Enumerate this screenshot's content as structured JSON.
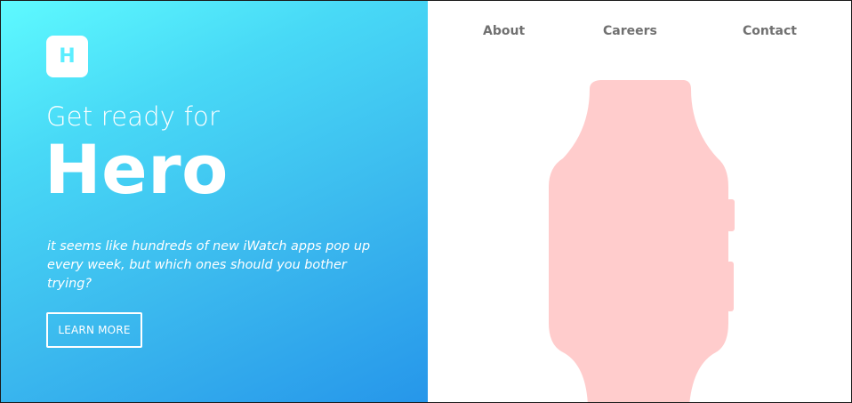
{
  "brand": {
    "logo_letter": "H"
  },
  "nav": {
    "items": [
      {
        "label": "About"
      },
      {
        "label": "Careers"
      },
      {
        "label": "Contact"
      }
    ]
  },
  "hero": {
    "tagline": "Get ready for",
    "title": "Hero",
    "description": "it seems like hundreds of new iWatch apps pop up every week, but which ones should you bother trying?",
    "cta_label": "LEARN MORE"
  },
  "colors": {
    "gradient_start": "#5efaff",
    "gradient_end": "#2696ea",
    "watch_color": "#ffcccc",
    "nav_text": "#707070"
  },
  "icons": {
    "logo": "letter-h-badge",
    "watch": "smartwatch-illustration"
  }
}
